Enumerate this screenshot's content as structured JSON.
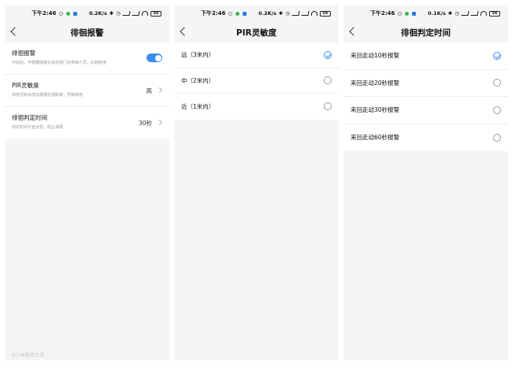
{
  "screens": [
    {
      "status": {
        "time": "下午2:46",
        "speed": "0.2K/s",
        "battery": "56"
      },
      "title": "徘徊报警",
      "rows": [
        {
          "title": "徘徊报警",
          "sub": "开启后，可根据摄像头会侦测门外徘徊人员，比较耗电",
          "toggle": true
        },
        {
          "title": "PIR灵敏度",
          "sub": "高度灵敏会增加报警检测距离，导致耗电",
          "value": "高"
        },
        {
          "title": "徘徊判定时间",
          "sub": "判定时间不宜太短，防止误报",
          "value": "30秒"
        }
      ]
    },
    {
      "status": {
        "time": "下午2:46",
        "speed": "0.2K/s",
        "battery": "56"
      },
      "title": "PIR灵敏度",
      "options": [
        {
          "label": "远（3米内）",
          "checked": true
        },
        {
          "label": "中（2米内）",
          "checked": false
        },
        {
          "label": "近（1米内）",
          "checked": false
        }
      ]
    },
    {
      "status": {
        "time": "下午2:46",
        "speed": "0.1K/s",
        "battery": "56"
      },
      "title": "徘徊判定时间",
      "options": [
        {
          "label": "来回走动10秒报警",
          "checked": true
        },
        {
          "label": "来回走动20秒报警",
          "checked": false
        },
        {
          "label": "来回走动30秒报警",
          "checked": false
        },
        {
          "label": "来回走动60秒报警",
          "checked": false
        }
      ]
    }
  ],
  "watermark": "@小米智能生活",
  "colors": {
    "accent": "#3b8cf5",
    "background": "#f5f5f5",
    "card": "#ffffff"
  }
}
